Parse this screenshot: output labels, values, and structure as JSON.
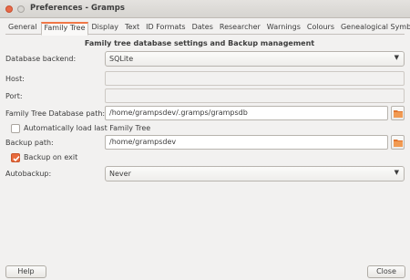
{
  "window": {
    "title": "Preferences - Gramps"
  },
  "tabs": [
    {
      "label": "General"
    },
    {
      "label": "Family Tree"
    },
    {
      "label": "Display"
    },
    {
      "label": "Text"
    },
    {
      "label": "ID Formats"
    },
    {
      "label": "Dates"
    },
    {
      "label": "Researcher"
    },
    {
      "label": "Warnings"
    },
    {
      "label": "Colours"
    },
    {
      "label": "Genealogical Symbols"
    }
  ],
  "panel": {
    "heading": "Family tree database settings and Backup management",
    "database_backend": {
      "label": "Database backend:",
      "value": "SQLite"
    },
    "host": {
      "label": "Host:",
      "value": ""
    },
    "port": {
      "label": "Port:",
      "value": ""
    },
    "db_path": {
      "label": "Family Tree Database path:",
      "value": "/home/grampsdev/.gramps/grampsdb"
    },
    "autoload": {
      "label": "Automatically load last Family Tree",
      "checked": false
    },
    "backup_path": {
      "label": "Backup path:",
      "value": "/home/grampsdev"
    },
    "backup_on_exit": {
      "label": "Backup on exit",
      "checked": true
    },
    "autobackup": {
      "label": "Autobackup:",
      "value": "Never"
    }
  },
  "buttons": {
    "help": "Help",
    "close": "Close"
  },
  "colors": {
    "accent": "#f07746",
    "background": "#f2f1f0"
  }
}
